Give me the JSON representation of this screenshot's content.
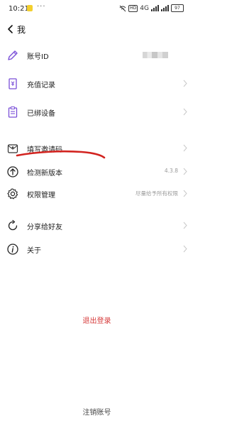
{
  "status_bar": {
    "time": "10:21",
    "dots": "···",
    "network": "4G",
    "hd": "HD",
    "battery": "97"
  },
  "nav": {
    "back_label": "我"
  },
  "menu": {
    "items": [
      {
        "label": "账号ID",
        "icon": "pencil-icon"
      },
      {
        "label": "充值记录",
        "icon": "receipt-icon"
      },
      {
        "label": "已绑设备",
        "icon": "clipboard-icon"
      },
      {
        "label": "填写邀请码",
        "icon": "envelope-icon"
      },
      {
        "label": "检测新版本",
        "icon": "arrow-up-circle-icon",
        "value": "4.3.8"
      },
      {
        "label": "权限管理",
        "icon": "gear-icon",
        "value": "尽量给予所有权限"
      },
      {
        "label": "分享给好友",
        "icon": "share-icon"
      },
      {
        "label": "关于",
        "icon": "info-icon"
      }
    ]
  },
  "actions": {
    "logout": "退出登录",
    "cancel_account": "注销账号"
  },
  "colors": {
    "accent_purple": "#7a4fd8",
    "danger_red": "#d63a3a",
    "annotation_red": "#d2231f"
  }
}
